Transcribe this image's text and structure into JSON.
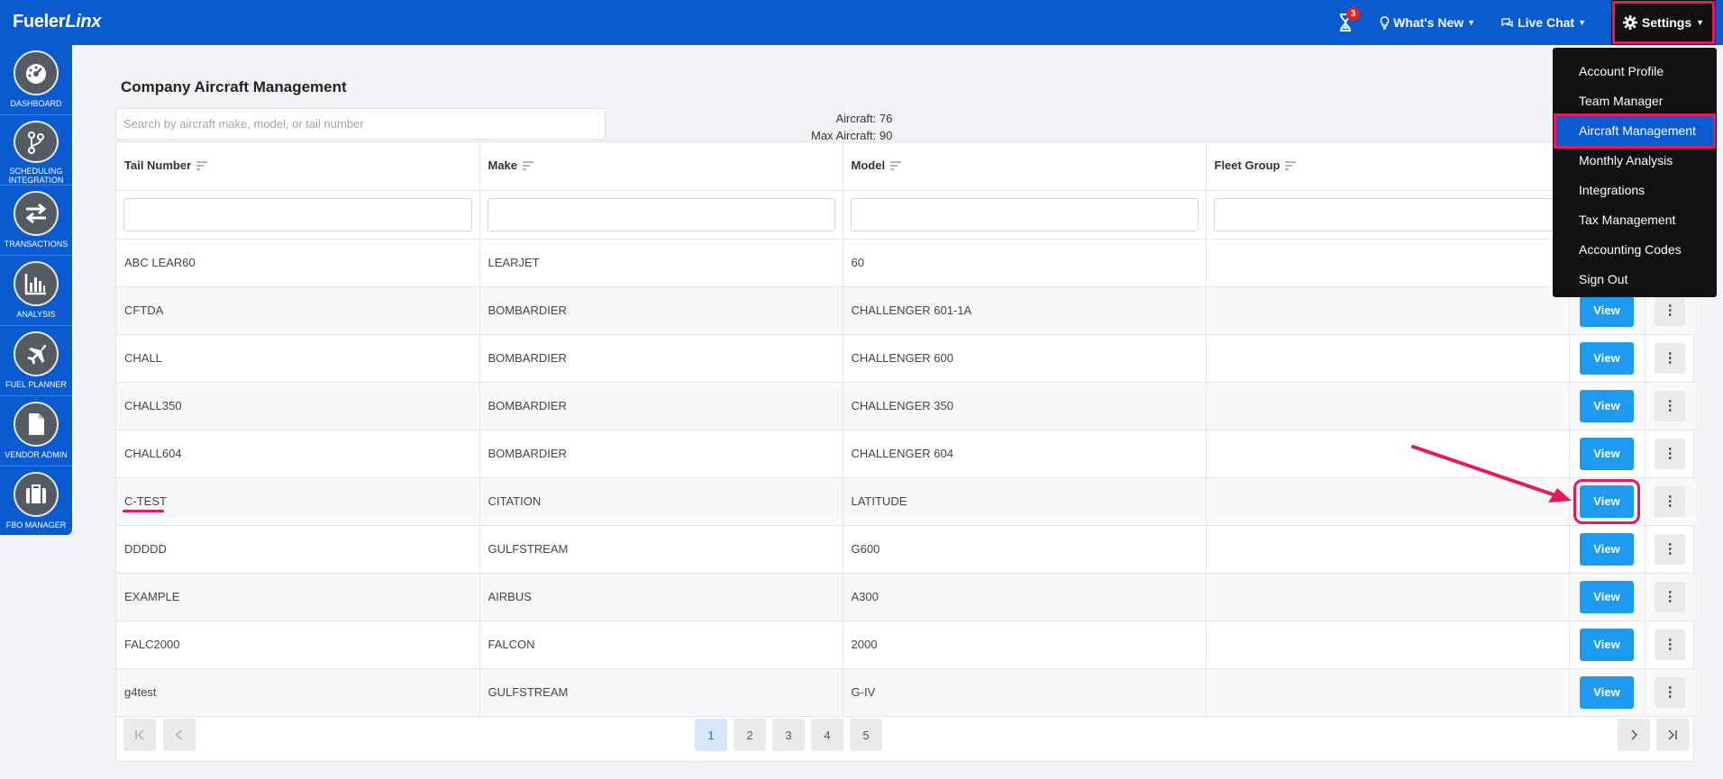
{
  "brand": {
    "prefix": "Fueler",
    "suffix": "Linx"
  },
  "topbar": {
    "notification_count": "3",
    "whats_new": "What's New",
    "live_chat": "Live Chat",
    "settings": "Settings"
  },
  "sidebar": {
    "items": [
      {
        "label": "DASHBOARD",
        "icon": "dashboard-icon"
      },
      {
        "label": "SCHEDULING INTEGRATION",
        "icon": "branch-icon"
      },
      {
        "label": "TRANSACTIONS",
        "icon": "swap-icon"
      },
      {
        "label": "ANALYSIS",
        "icon": "bar-chart-icon"
      },
      {
        "label": "FUEL PLANNER",
        "icon": "plane-icon"
      },
      {
        "label": "VENDOR ADMIN",
        "icon": "document-icon"
      },
      {
        "label": "FBO MANAGER",
        "icon": "briefcase-icon"
      }
    ]
  },
  "page": {
    "title": "Company Aircraft Management",
    "search_placeholder": "Search by aircraft make, model, or tail number",
    "aircraft_count": "Aircraft: 76",
    "max_aircraft": "Max Aircraft: 90"
  },
  "table": {
    "headers": [
      "Tail Number",
      "Make",
      "Model",
      "Fleet Group"
    ],
    "view_label": "View",
    "rows": [
      {
        "tail": "ABC LEAR60",
        "make": "LEARJET",
        "model": "60",
        "fleet": ""
      },
      {
        "tail": "CFTDA",
        "make": "BOMBARDIER",
        "model": "CHALLENGER 601-1A",
        "fleet": ""
      },
      {
        "tail": "CHALL",
        "make": "BOMBARDIER",
        "model": "CHALLENGER 600",
        "fleet": ""
      },
      {
        "tail": "CHALL350",
        "make": "BOMBARDIER",
        "model": "CHALLENGER 350",
        "fleet": ""
      },
      {
        "tail": "CHALL604",
        "make": "BOMBARDIER",
        "model": "CHALLENGER 604",
        "fleet": ""
      },
      {
        "tail": "C-TEST",
        "make": "CITATION",
        "model": "LATITUDE",
        "fleet": ""
      },
      {
        "tail": "DDDDD",
        "make": "GULFSTREAM",
        "model": "G600",
        "fleet": ""
      },
      {
        "tail": "EXAMPLE",
        "make": "AIRBUS",
        "model": "A300",
        "fleet": ""
      },
      {
        "tail": "FALC2000",
        "make": "FALCON",
        "model": "2000",
        "fleet": ""
      },
      {
        "tail": "g4test",
        "make": "GULFSTREAM",
        "model": "G-IV",
        "fleet": ""
      }
    ]
  },
  "pagination": {
    "pages": [
      "1",
      "2",
      "3",
      "4",
      "5"
    ],
    "current": "1"
  },
  "settings_menu": {
    "items": [
      "Account Profile",
      "Team Manager",
      "Aircraft Management",
      "Monthly Analysis",
      "Integrations",
      "Tax Management",
      "Accounting Codes",
      "Sign Out"
    ],
    "active": "Aircraft Management"
  },
  "colors": {
    "brand_blue": "#0a5bd0",
    "view_button": "#1e9bf0",
    "highlight": "#e6195c",
    "menu_bg": "#111111"
  }
}
